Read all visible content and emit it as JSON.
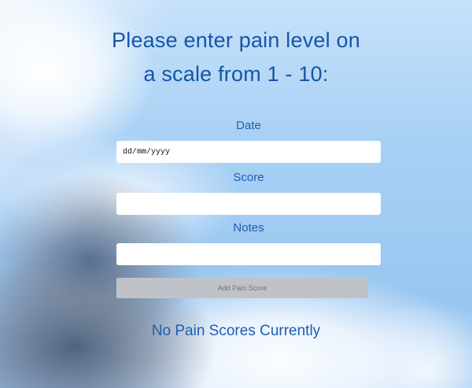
{
  "header": {
    "title_line_1": "Please enter pain level on",
    "title_line_2": "a scale from 1 - 10:"
  },
  "form": {
    "date": {
      "label": "Date",
      "value": "dd/mm/yyyy"
    },
    "score": {
      "label": "Score",
      "value": ""
    },
    "notes": {
      "label": "Notes",
      "value": ""
    },
    "submit_label": "Add Pain Score"
  },
  "status": {
    "empty_message": "No Pain Scores Currently"
  }
}
